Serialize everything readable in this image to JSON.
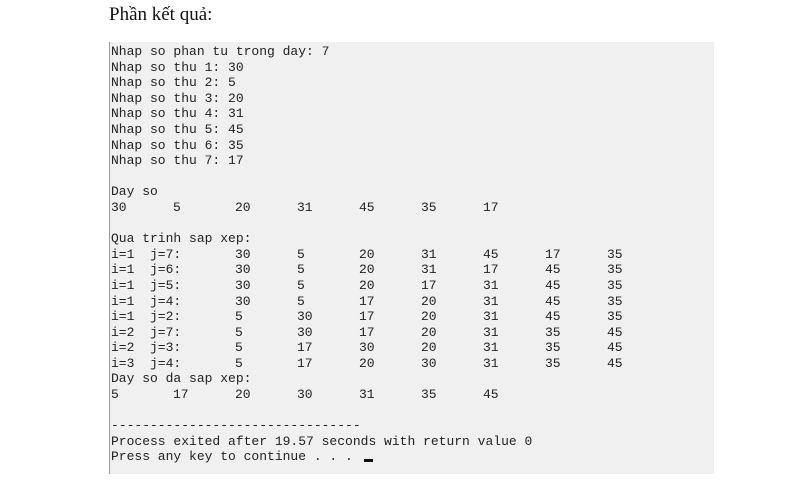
{
  "heading": "Phần kết quả:",
  "console": {
    "input_lines": [
      "Nhap so phan tu trong day: 7",
      "Nhap so thu 1: 30",
      "Nhap so thu 2: 5",
      "Nhap so thu 3: 20",
      "Nhap so thu 4: 31",
      "Nhap so thu 5: 45",
      "Nhap so thu 6: 35",
      "Nhap so thu 7: 17"
    ],
    "initial_label": "Day so",
    "initial_values": [
      "30",
      "5",
      "20",
      "31",
      "45",
      "35",
      "17"
    ],
    "process_label": "Qua trinh sap xep:",
    "steps": [
      {
        "label": "i=1  j=7:",
        "values": [
          "30",
          "5",
          "20",
          "31",
          "45",
          "17",
          "35"
        ]
      },
      {
        "label": "i=1  j=6:",
        "values": [
          "30",
          "5",
          "20",
          "31",
          "17",
          "45",
          "35"
        ]
      },
      {
        "label": "i=1  j=5:",
        "values": [
          "30",
          "5",
          "20",
          "17",
          "31",
          "45",
          "35"
        ]
      },
      {
        "label": "i=1  j=4:",
        "values": [
          "30",
          "5",
          "17",
          "20",
          "31",
          "45",
          "35"
        ]
      },
      {
        "label": "i=1  j=2:",
        "values": [
          "5",
          "30",
          "17",
          "20",
          "31",
          "45",
          "35"
        ]
      },
      {
        "label": "i=2  j=7:",
        "values": [
          "5",
          "30",
          "17",
          "20",
          "31",
          "35",
          "45"
        ]
      },
      {
        "label": "i=2  j=3:",
        "values": [
          "5",
          "17",
          "30",
          "20",
          "31",
          "35",
          "45"
        ]
      },
      {
        "label": "i=3  j=4:",
        "values": [
          "5",
          "17",
          "20",
          "30",
          "31",
          "35",
          "45"
        ]
      }
    ],
    "sorted_label": "Day so da sap xep:",
    "sorted_values": [
      "5",
      "17",
      "20",
      "30",
      "31",
      "35",
      "45"
    ],
    "separator": "--------------------------------",
    "exit_message": "Process exited after 19.57 seconds with return value 0",
    "continue_prompt": "Press any key to continue . . . "
  }
}
